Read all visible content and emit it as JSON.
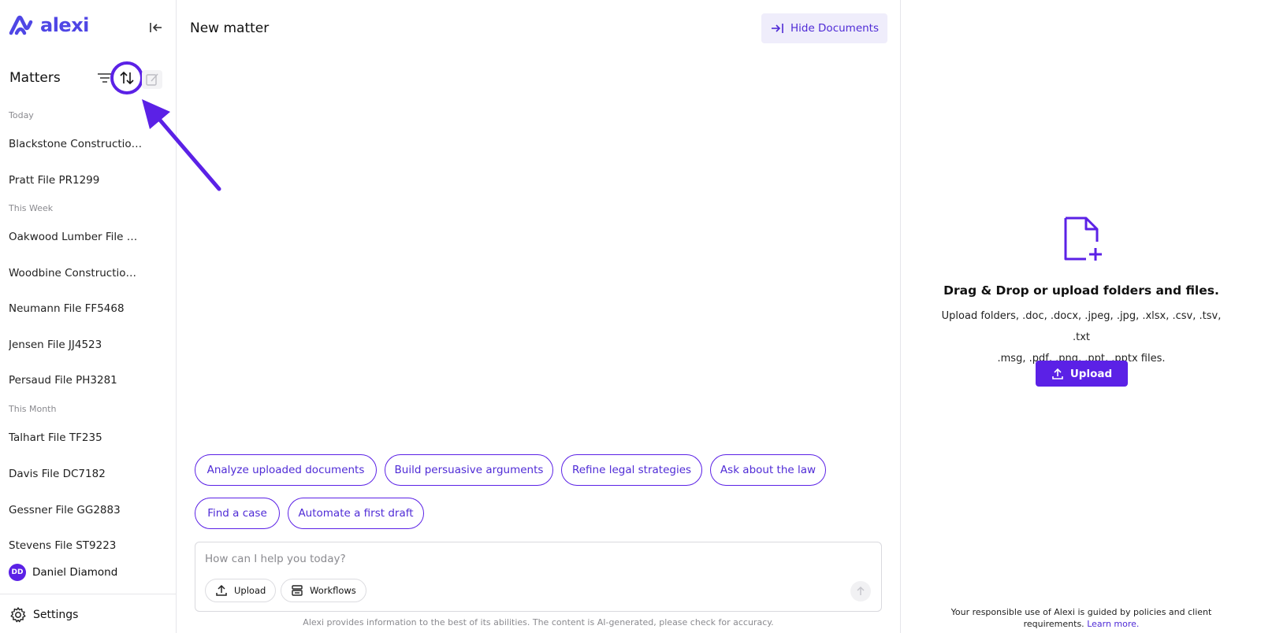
{
  "brand": {
    "name": "alexi",
    "accent": "#5b21e6"
  },
  "sidebar": {
    "title": "Matters",
    "sections": [
      {
        "label": "Today",
        "items": [
          "Blackstone Construction…",
          "Pratt File PR1299"
        ]
      },
      {
        "label": "This Week",
        "items": [
          "Oakwood Lumber File FT…",
          "Woodbine Construction …",
          "Neumann File FF5468",
          "Jensen File JJ4523",
          "Persaud File PH3281"
        ]
      },
      {
        "label": "This Month",
        "items": [
          "Talhart File TF235",
          "Davis File DC7182",
          "Gessner File GG2883",
          "Stevens File ST9223"
        ]
      }
    ],
    "user": {
      "initials": "DD",
      "name": "Daniel Diamond"
    },
    "settings_label": "Settings"
  },
  "main": {
    "title": "New matter",
    "hide_documents_label": "Hide Documents",
    "chips": [
      "Analyze uploaded documents",
      "Build persuasive arguments",
      "Refine legal strategies",
      "Ask about the law",
      "Find a case",
      "Automate a first draft"
    ],
    "composer": {
      "placeholder": "How can I help you today?",
      "upload_label": "Upload",
      "workflows_label": "Workflows"
    },
    "disclaimer": "Alexi provides information to the best of its abilities. The content is AI-generated, please check for accuracy."
  },
  "docs_panel": {
    "title": "Drag & Drop or upload folders and files.",
    "desc_line1": "Upload folders, .doc, .docx, .jpeg, .jpg, .xlsx, .csv, .tsv, .txt",
    "desc_line2": ".msg, .pdf, .png, .ppt, .pptx files.",
    "upload_label": "Upload",
    "policy_text": "Your responsible use of Alexi is guided by policies and client requirements.",
    "policy_link": "Learn more."
  }
}
